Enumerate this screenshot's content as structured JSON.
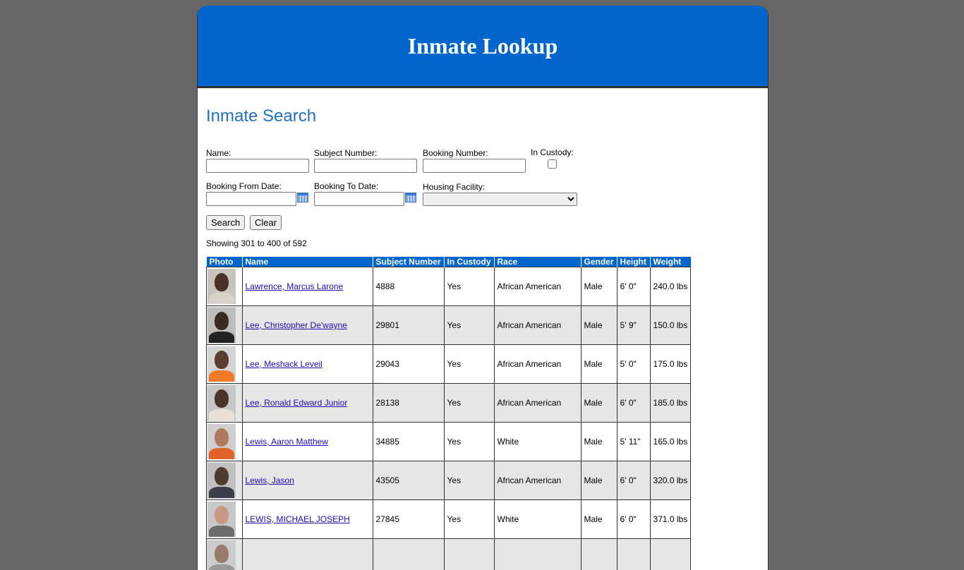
{
  "header": {
    "title": "Inmate Lookup"
  },
  "search": {
    "title": "Inmate Search",
    "name_label": "Name:",
    "subject_label": "Subject Number:",
    "booking_label": "Booking Number:",
    "custody_label": "In Custody:",
    "from_label": "Booking From Date:",
    "to_label": "Booking To Date:",
    "facility_label": "Housing Facility:",
    "search_button": "Search",
    "clear_button": "Clear"
  },
  "results": {
    "showing": "Showing 301 to 400 of 592",
    "columns": [
      "Photo",
      "Name",
      "Subject Number",
      "In Custody",
      "Race",
      "Gender",
      "Height",
      "Weight"
    ],
    "rows": [
      {
        "name": "Lawrence, Marcus Larone",
        "subject": "4888",
        "custody": "Yes",
        "race": "African American",
        "gender": "Male",
        "height": "6' 0\"",
        "weight": "240.0 lbs",
        "skin": "#4a3326",
        "shirt": "#d9d2c8",
        "bg": "#c9c4bc"
      },
      {
        "name": "Lee, Christopher De'wayne",
        "subject": "29801",
        "custody": "Yes",
        "race": "African American",
        "gender": "Male",
        "height": "5' 9\"",
        "weight": "150.0 lbs",
        "skin": "#3b2a20",
        "shirt": "#222222",
        "bg": "#bdbdbd"
      },
      {
        "name": "Lee, Meshack Leveil",
        "subject": "29043",
        "custody": "Yes",
        "race": "African American",
        "gender": "Male",
        "height": "5' 0\"",
        "weight": "175.0 lbs",
        "skin": "#5a3d2c",
        "shirt": "#f07a2a",
        "bg": "#d4d4d4"
      },
      {
        "name": "Lee, Ronald Edward Junior",
        "subject": "28138",
        "custody": "Yes",
        "race": "African American",
        "gender": "Male",
        "height": "6' 0\"",
        "weight": "185.0 lbs",
        "skin": "#4b3428",
        "shirt": "#e8e1d8",
        "bg": "#c6c6c6"
      },
      {
        "name": "Lewis, Aaron Matthew",
        "subject": "34885",
        "custody": "Yes",
        "race": "White",
        "gender": "Male",
        "height": "5' 11\"",
        "weight": "165.0 lbs",
        "skin": "#b07a5e",
        "shirt": "#e0632a",
        "bg": "#cfcfcf"
      },
      {
        "name": "Lewis, Jason",
        "subject": "43505",
        "custody": "Yes",
        "race": "African American",
        "gender": "Male",
        "height": "6' 0\"",
        "weight": "320.0 lbs",
        "skin": "#4f3a2e",
        "shirt": "#3a3f4a",
        "bg": "#c0c0c0"
      },
      {
        "name": "LEWIS, MICHAEL JOSEPH",
        "subject": "27845",
        "custody": "Yes",
        "race": "White",
        "gender": "Male",
        "height": "6' 0\"",
        "weight": "371.0 lbs",
        "skin": "#c69a84",
        "shirt": "#6d6d6d",
        "bg": "#c8c8c8"
      },
      {
        "name": "",
        "subject": "",
        "custody": "",
        "race": "",
        "gender": "",
        "height": "",
        "weight": "",
        "skin": "#9a7a6a",
        "shirt": "#999999",
        "bg": "#cccccc"
      }
    ]
  }
}
